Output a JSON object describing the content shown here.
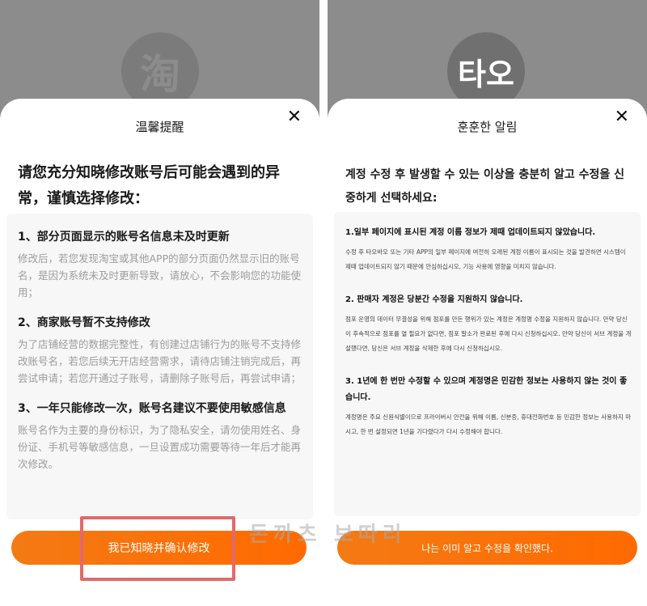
{
  "left": {
    "logo_text": "淘",
    "title": "温馨提醒",
    "close": "✕",
    "heading": "请您充分知晓修改账号后可能会遇到的异常，谨慎选择修改：",
    "items": [
      {
        "title": "1、部分页面显示的账号名信息未及时更新",
        "body": "修改后，若您发现淘宝或其他APP的部分页面仍然显示旧的账号名，是因为系统未及时更新导致，请放心，不会影响您的功能使用；"
      },
      {
        "title": "2、商家账号暂不支持修改",
        "body": "为了店铺经营的数据完整性，有创建过店铺行为的账号不支持修改账号名，若您后续无开店经营需求，请待店铺注销完成后，再尝试申请；若您开通过子账号，请删除子账号后，再尝试申请；"
      },
      {
        "title": "3、一年只能修改一次，账号名建议不要使用敏感信息",
        "body": "账号名作为主要的身份标识，为了隐私安全，请勿使用姓名、身份证、手机号等敏感信息，一旦设置成功需要等待一年后才能再次修改。"
      }
    ],
    "confirm_label": "我已知晓并确认修改"
  },
  "right": {
    "logo_text": "타오",
    "title": "훈훈한 알림",
    "close": "✕",
    "heading": "계정 수정 후 발생할 수 있는 이상을 충분히 알고 수정을 신중하게 선택하세요:",
    "items": [
      {
        "title": "1.일부 페이지에 표시된 계정 이름 정보가 제때 업데이트되지 않았습니다.",
        "body": "수정 후 타오바오 또는 기타 APP의 일부 페이지에 여전히 오래된 계정 이름이 표시되는 것을 발견하면 시스템이 제때 업데이트되지 않기 때문에 안심하십시오, 기능 사용에 영향을 미치지 않습니다."
      },
      {
        "title": "2. 판매자 계정은 당분간 수정을 지원하지 않습니다.",
        "body": "점포 운영의 데이터 무결성을 위해 점포를 만든 행위가 있는 계정은 계정명 수정을 지원하지 않습니다. 만약 당신이 후속적으로 점포를 열 필요가 없다면, 점포 말소가 완료된 후에 다시 신청하십시오. 만약 당신이 서브 계정을 개설했다면, 당신은 서브 계정을 삭제한 후에 다시 신청하십시오."
      },
      {
        "title": "3. 1년에 한 번만 수정할 수 있으며 계정명은 민감한 정보는 사용하지 않는 것이 좋습니다.",
        "body": "계정명은 주요 신원식별이므로 프라이버시 안전을 위해 이름, 신분증, 휴대전화번호 등 민감한 정보는 사용하지 마시고, 한 번 설정되면 1년을 기다렸다가 다시 수정해야 합니다."
      }
    ],
    "confirm_label": "나는 이미 알고 수정을 확인했다."
  },
  "watermark": "돈까츠 보따리",
  "colors": {
    "accent": "#ff6a00",
    "highlight": "#e06a6a",
    "backdrop": "#8c8c8c"
  }
}
